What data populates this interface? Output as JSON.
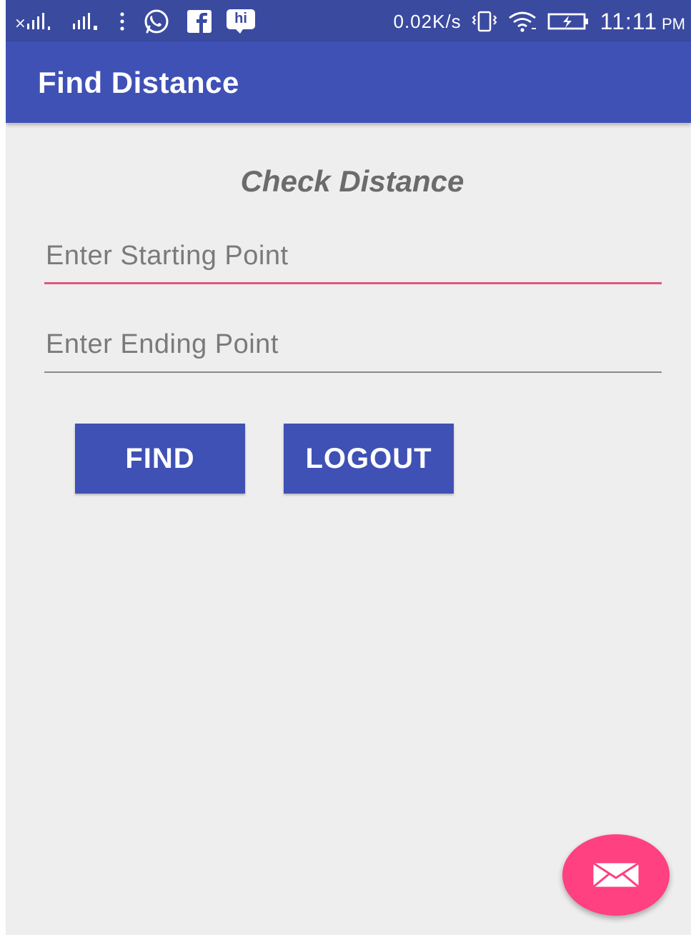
{
  "status_bar": {
    "network_speed": "0.02K/s",
    "time": "11:11",
    "ampm": "PM",
    "hike_label": "hi",
    "icons": [
      "signal-sim1-icon",
      "signal-sim2-icon",
      "more-vertical-icon",
      "whatsapp-icon",
      "facebook-icon",
      "hike-icon",
      "vibrate-icon",
      "wifi-icon",
      "battery-charging-icon"
    ]
  },
  "app_bar": {
    "title": "Find Distance"
  },
  "main": {
    "heading": "Check Distance",
    "start_field": {
      "placeholder": "Enter Starting Point",
      "value": ""
    },
    "end_field": {
      "placeholder": "Enter Ending Point",
      "value": ""
    },
    "find_label": "FIND",
    "logout_label": "LOGOUT"
  },
  "fab": {
    "icon": "mail-icon"
  },
  "colors": {
    "primary": "#3f51b5",
    "status_bar": "#3a4a9f",
    "accent": "#ff4081",
    "background": "#eeeeee"
  }
}
